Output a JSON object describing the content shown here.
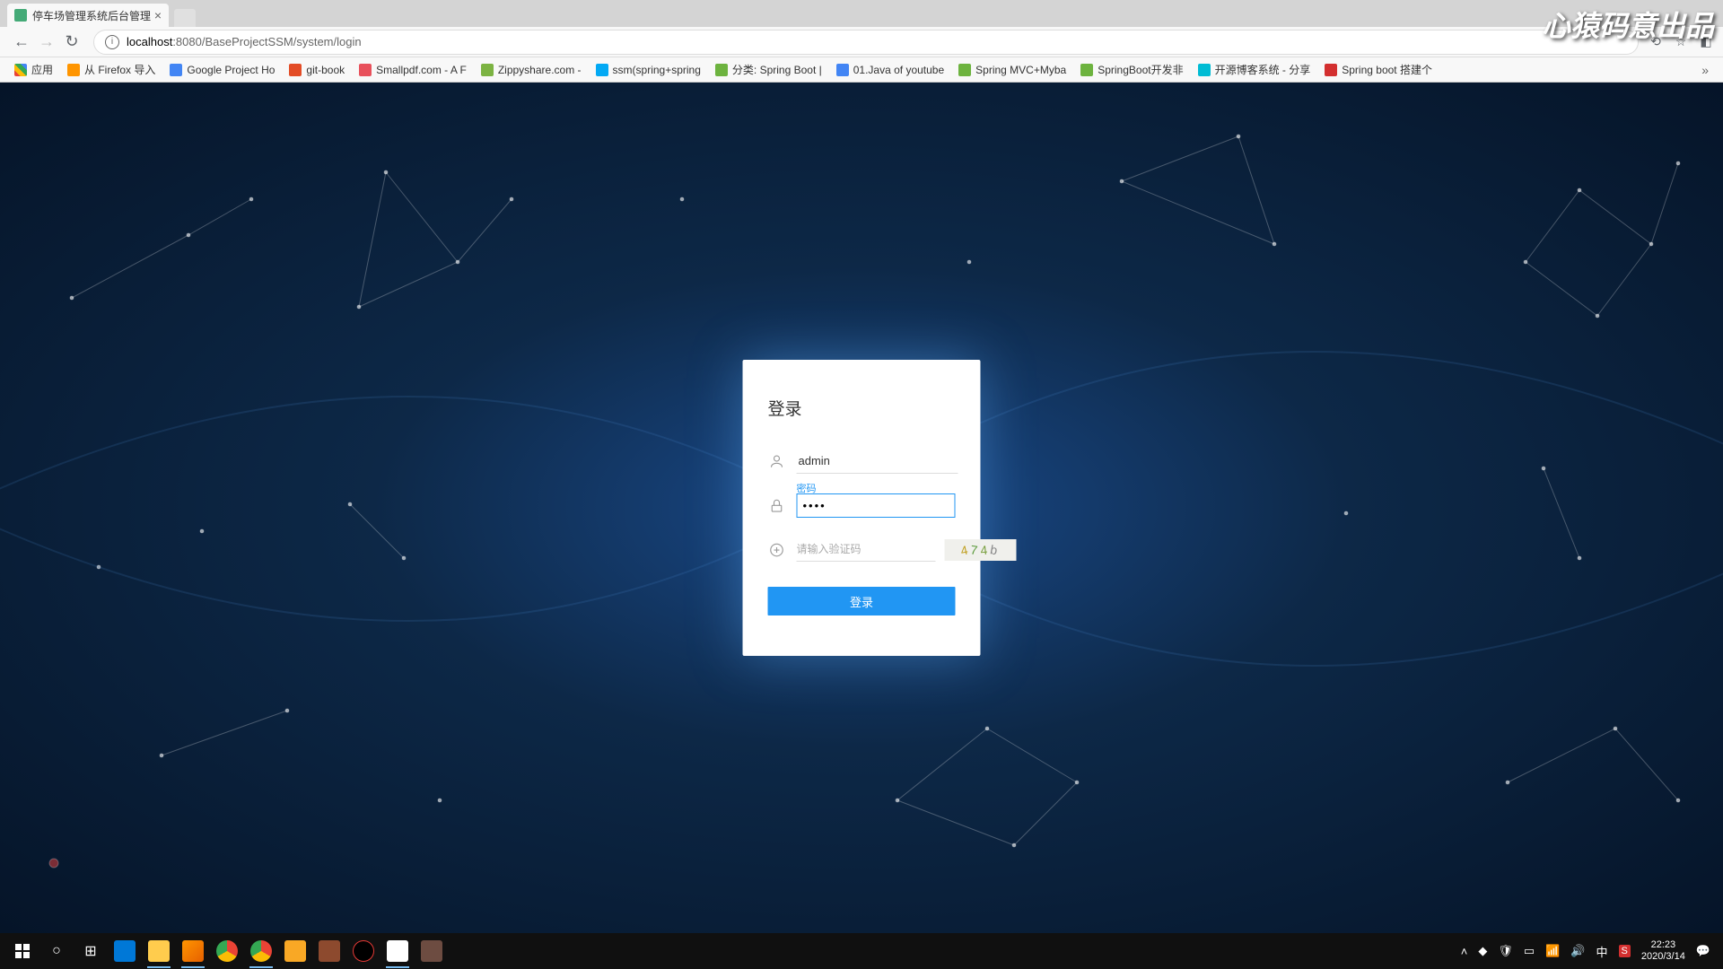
{
  "browser": {
    "tab_title": "停车场管理系统后台管理",
    "url_host": "localhost",
    "url_port_path": ":8080/BaseProjectSSM/system/login"
  },
  "bookmarks": {
    "apps": "应用",
    "items": [
      "从 Firefox 导入",
      "Google Project Ho",
      "git-book",
      "Smallpdf.com - A F",
      "Zippyshare.com - ",
      "ssm(spring+spring",
      "分类: Spring Boot |",
      "01.Java of youtube",
      "Spring MVC+Myba",
      "SpringBoot开发非",
      "开源博客系统 - 分享",
      "Spring boot 搭建个"
    ]
  },
  "login": {
    "heading": "登录",
    "username_value": "admin",
    "password_label": "密码",
    "password_value": "••••",
    "captcha_placeholder": "请输入验证码",
    "captcha_chars": [
      "4",
      "7",
      "4",
      "b"
    ],
    "submit_label": "登录"
  },
  "watermark": "心猿码意出品",
  "taskbar": {
    "time": "22:23",
    "date": "2020/3/14"
  }
}
